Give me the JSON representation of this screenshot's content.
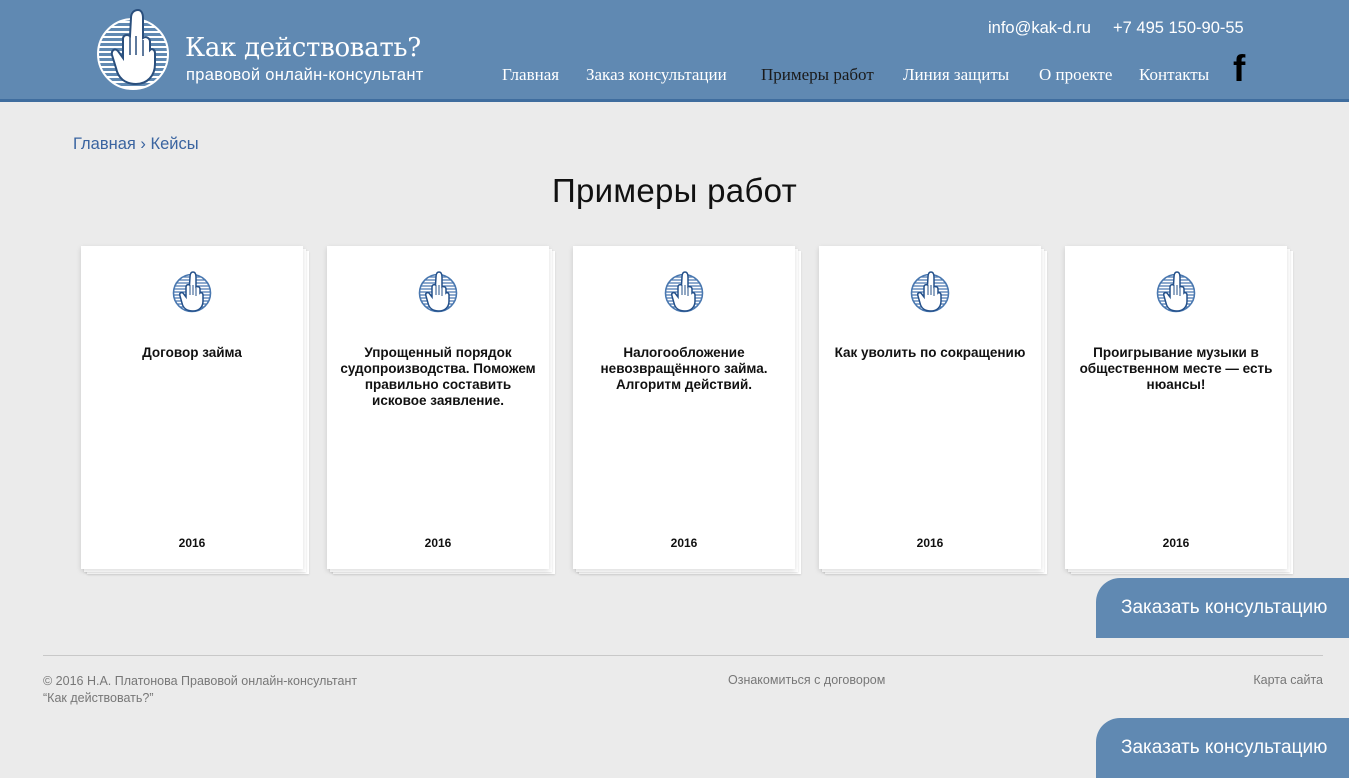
{
  "header": {
    "logo_title": "Как действовать?",
    "logo_subtitle": "правовой онлайн-консультант",
    "email": "info@kak-d.ru",
    "phone": "+7 495 150-90-55",
    "social_icon": "facebook-icon",
    "social_glyph": "f",
    "nav": [
      {
        "label": "Главная",
        "active": false
      },
      {
        "label": "Заказ консультации",
        "active": false
      },
      {
        "label": "Примеры работ",
        "active": true
      },
      {
        "label": "Линия защиты",
        "active": false
      },
      {
        "label": "О проекте",
        "active": false
      },
      {
        "label": "Контакты",
        "active": false
      }
    ]
  },
  "breadcrumb": {
    "home": "Главная",
    "separator": "›",
    "current": "Кейсы"
  },
  "page_title": "Примеры работ",
  "cards": [
    {
      "title": "Договор займа",
      "year": "2016",
      "icon": "raised-hand-icon"
    },
    {
      "title": "Упрощенный порядок судопроизводства. Поможем правильно составить исковое заявление.",
      "year": "2016",
      "icon": "raised-hand-icon"
    },
    {
      "title": "Налогообложение невозвращённого займа. Алгоритм действий.",
      "year": "2016",
      "icon": "raised-hand-icon"
    },
    {
      "title": "Как уволить по сокращению",
      "year": "2016",
      "icon": "raised-hand-icon"
    },
    {
      "title": "Проигрывание музыки в общественном месте — есть нюансы!",
      "year": "2016",
      "icon": "raised-hand-icon"
    }
  ],
  "consult_button": "Заказать консультацию",
  "footer": {
    "copyright_line1": "© 2016 Н.А. Платонова Правовой онлайн-консультант",
    "copyright_line2": "“Как действовать?”",
    "contract_link": "Ознакомиться с договором",
    "sitemap_link": "Карта сайта"
  },
  "colors": {
    "header_bg": "#6089b2",
    "header_border": "#3f6d9e",
    "page_bg": "#ebebeb",
    "link": "#3a64a0",
    "accent_blue": "#4a78b0"
  }
}
